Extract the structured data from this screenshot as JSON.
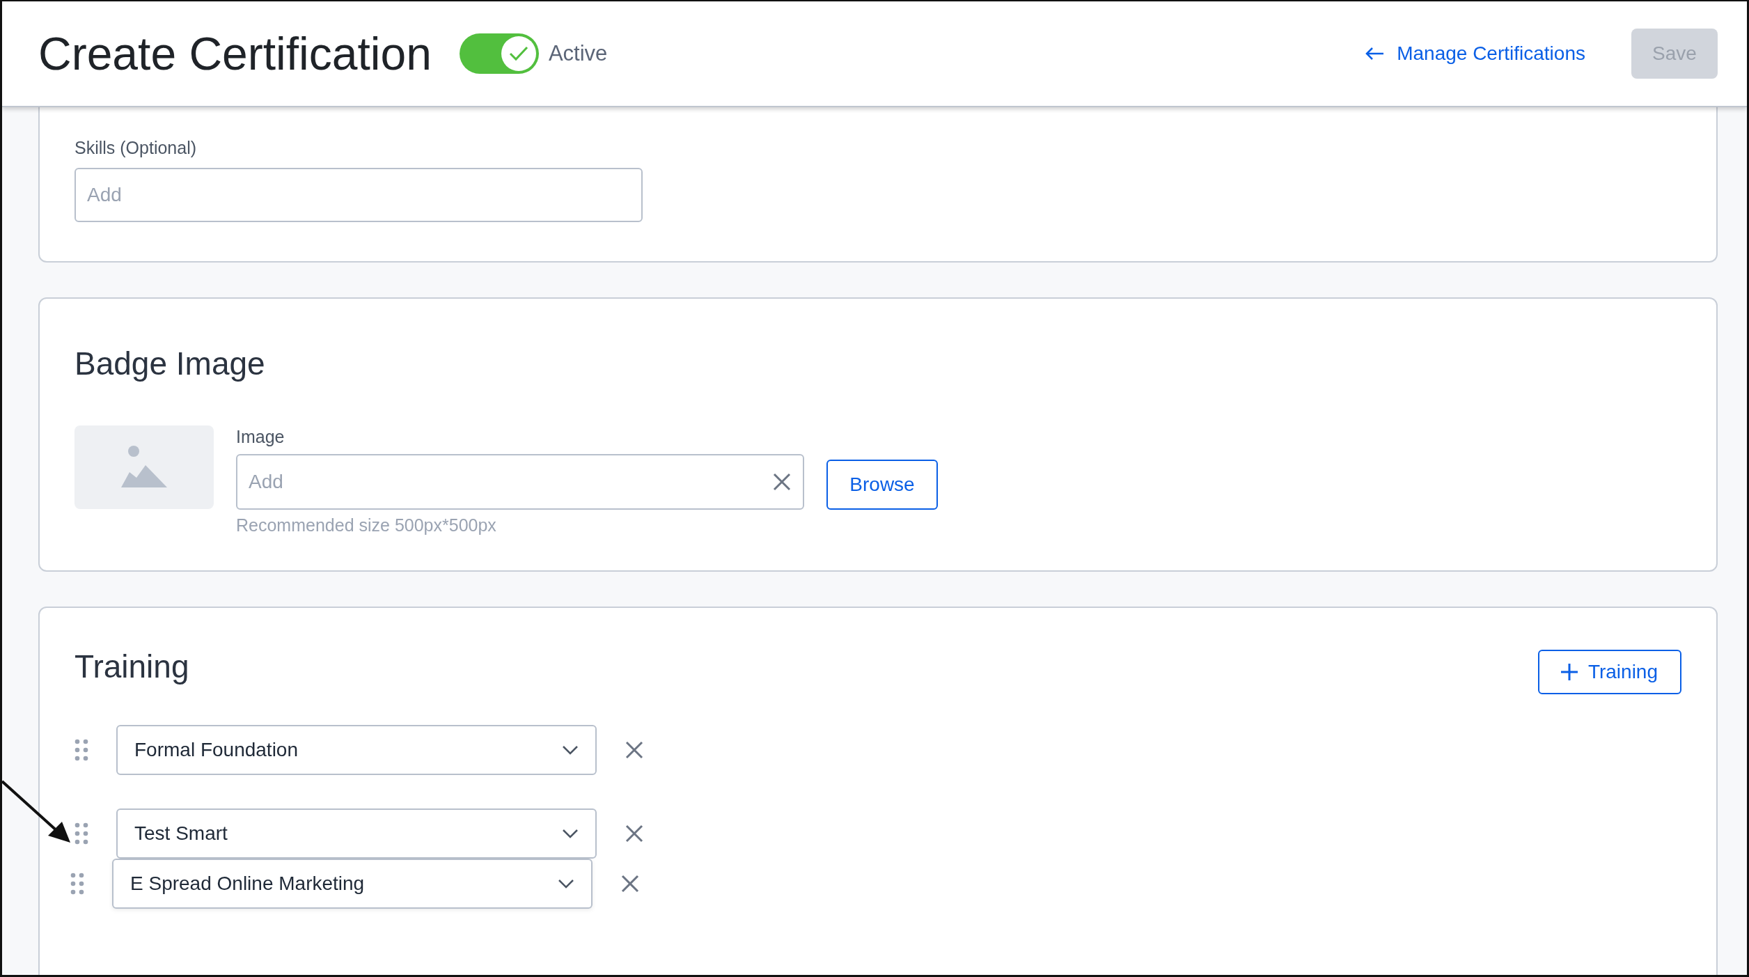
{
  "header": {
    "title": "Create Certification",
    "status_toggle": {
      "on": true,
      "label": "Active"
    },
    "back_link": "Manage Certifications",
    "save_button": {
      "label": "Save",
      "disabled": true
    }
  },
  "skills": {
    "label": "Skills (Optional)",
    "placeholder": "Add"
  },
  "badge_image": {
    "heading": "Badge Image",
    "label": "Image",
    "placeholder": "Add",
    "hint": "Recommended size 500px*500px",
    "browse_button": "Browse"
  },
  "training": {
    "heading": "Training",
    "add_button": "Training",
    "items": [
      {
        "name": "Formal Foundation",
        "dragging": false
      },
      {
        "name": "Test Smart",
        "dragging": false
      },
      {
        "name": "E Spread Online Marketing",
        "dragging": true
      }
    ]
  }
}
